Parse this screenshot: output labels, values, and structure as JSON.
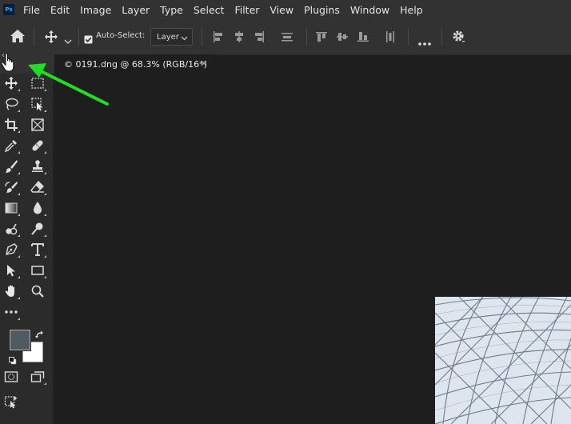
{
  "app": {
    "logo_text": "Ps"
  },
  "menubar": {
    "items": [
      "File",
      "Edit",
      "Image",
      "Layer",
      "Type",
      "Select",
      "Filter",
      "View",
      "Plugins",
      "Window",
      "Help"
    ]
  },
  "options_bar": {
    "auto_select_label": "Auto-Select:",
    "auto_select_checked": true,
    "layer_value": "Layer"
  },
  "document": {
    "tab_title": "© 0191.dng @ 68.3% (RGB/16*)",
    "close_glyph": "×"
  },
  "toolbar": {
    "collapse_glyph": "‹‹"
  },
  "colors": {
    "foreground": "#4f5a63",
    "background": "#ffffff",
    "annotation_arrow": "#22dd22"
  }
}
